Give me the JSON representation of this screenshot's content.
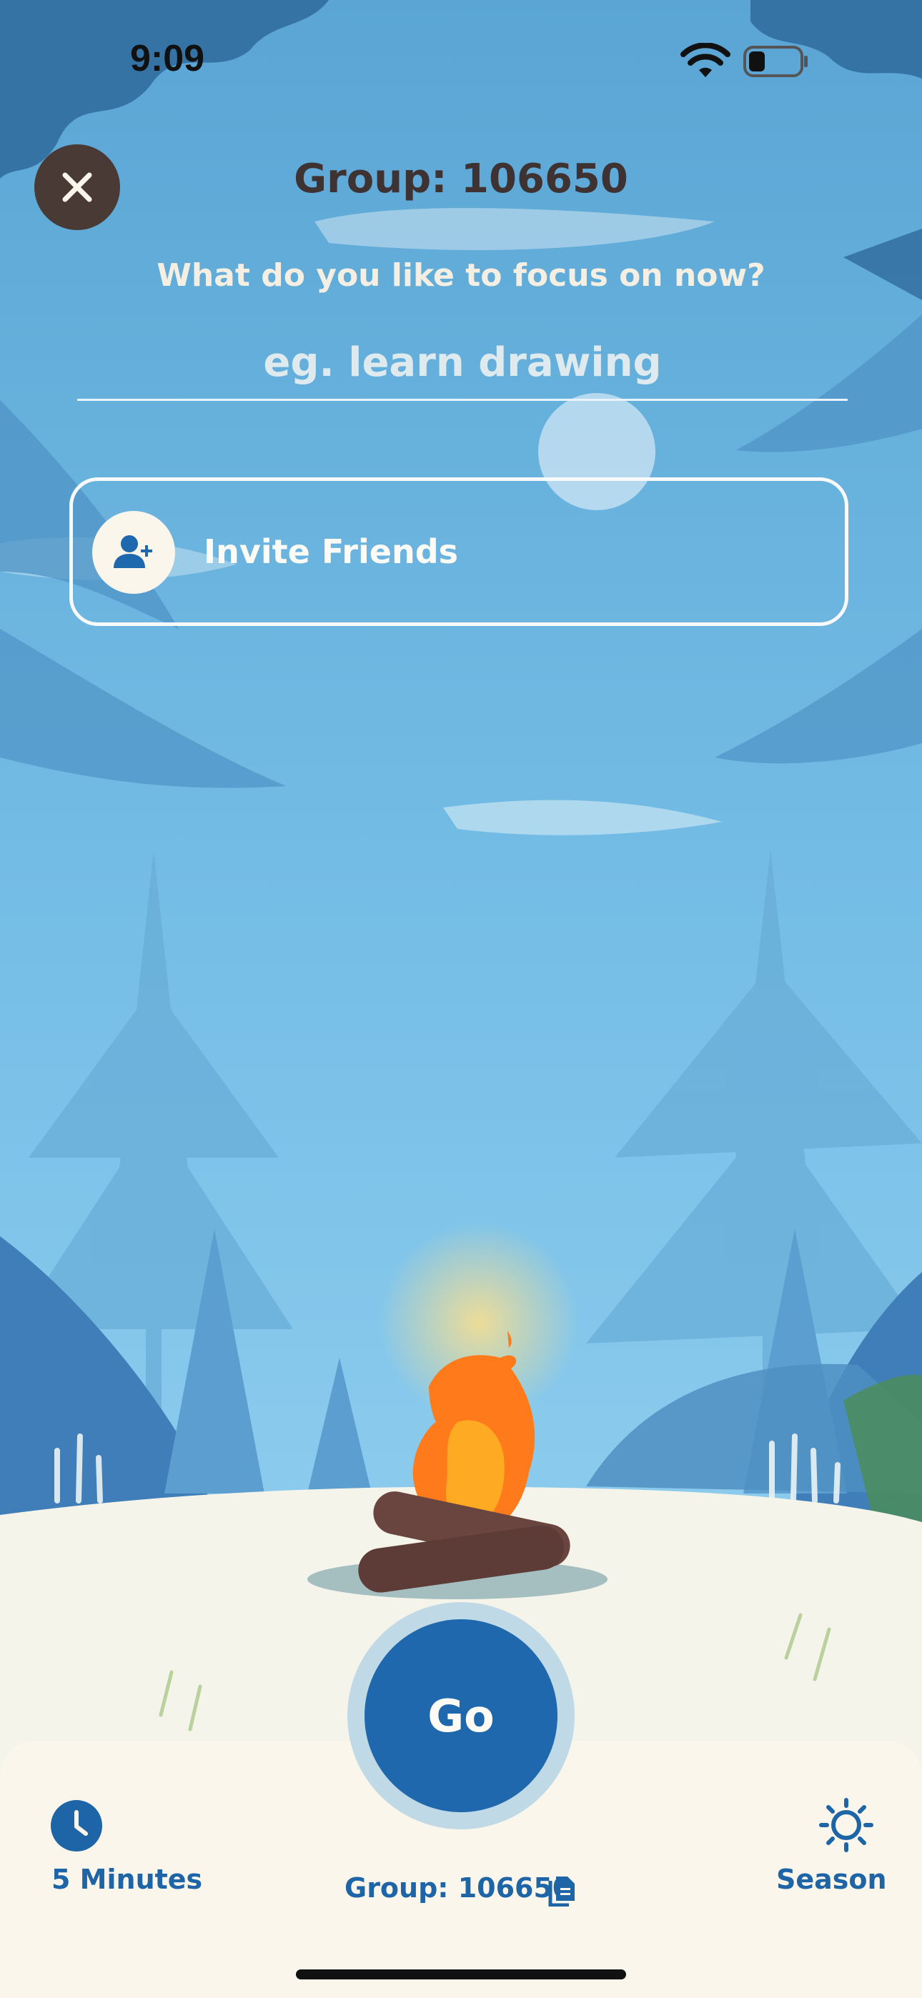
{
  "status_bar": {
    "time": "9:09",
    "icons": [
      "wifi-icon",
      "battery-icon"
    ]
  },
  "header": {
    "close_icon": "close-icon",
    "group_title": "Group: 106650"
  },
  "focus": {
    "prompt": "What do you like to focus on now?",
    "input_value": "",
    "placeholder": "eg. learn drawing"
  },
  "invite": {
    "label": "Invite Friends",
    "icon": "add-person-icon"
  },
  "go_button": {
    "label": "Go"
  },
  "bottom_bar": {
    "timer": {
      "label": "5 Minutes",
      "icon": "clock-icon"
    },
    "group_code": {
      "label": "Group: 106650",
      "icon": "copy-icon"
    },
    "season": {
      "label": "Season",
      "icon": "sun-icon"
    }
  },
  "colors": {
    "sky": "#6eb9e0",
    "close_button": "#4a3a36",
    "go_button": "#2068ad",
    "go_ring": "#c0d9e6",
    "panel": "#faf6ec",
    "accent_text": "#1d65a6",
    "fire": "#ff7a1a"
  }
}
